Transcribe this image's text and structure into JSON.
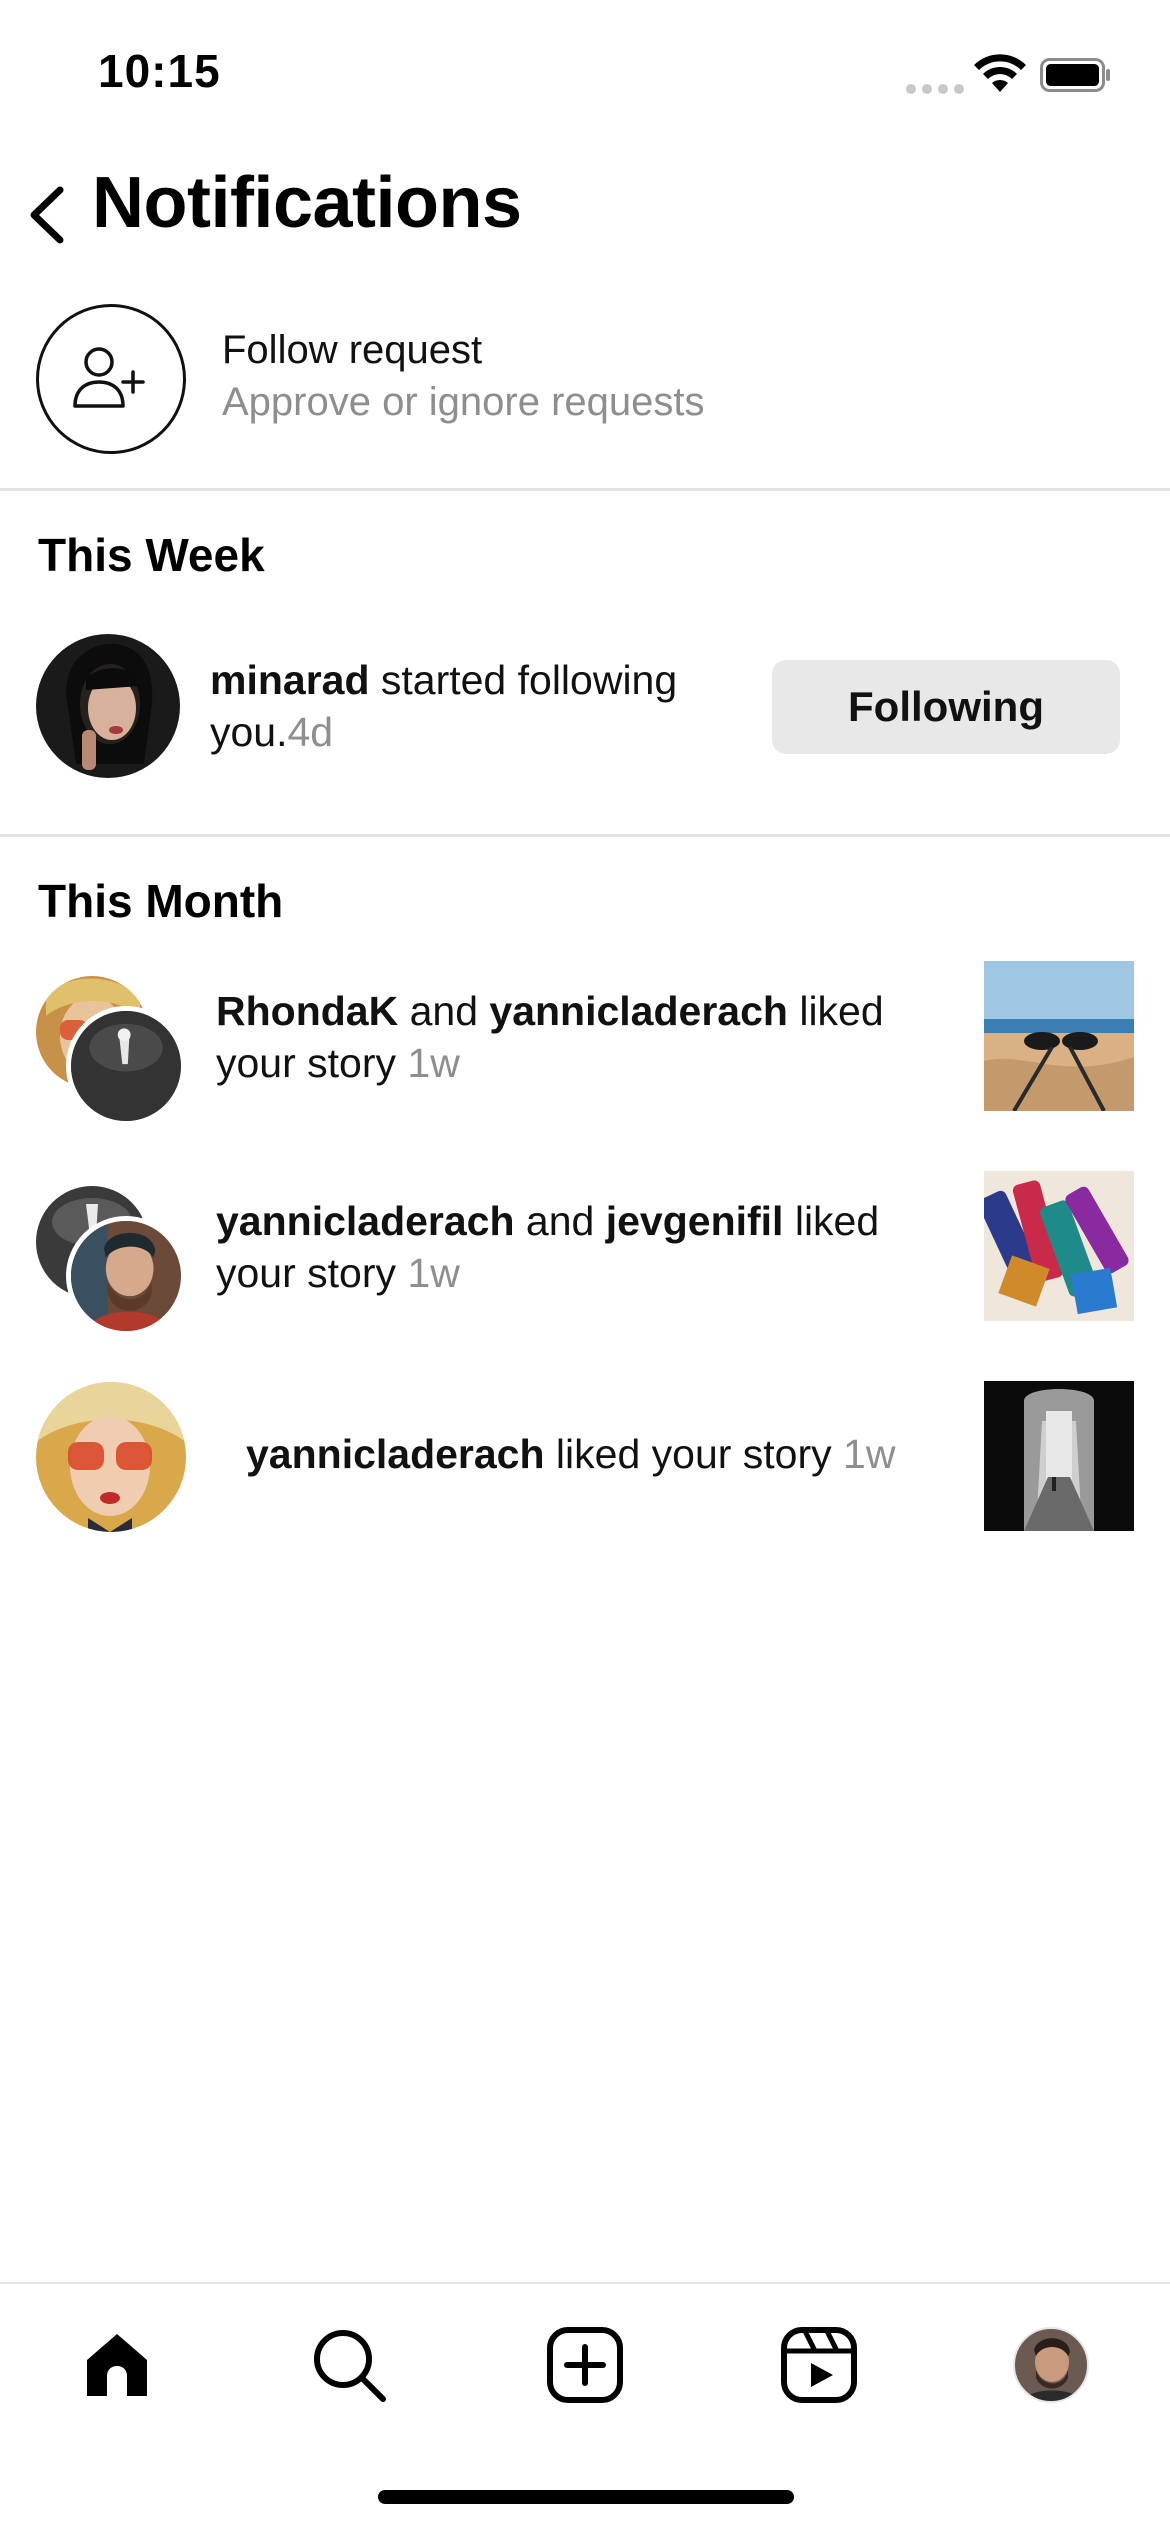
{
  "status_bar": {
    "time": "10:15"
  },
  "header": {
    "title": "Notifications"
  },
  "follow_request": {
    "title": "Follow request",
    "subtitle": "Approve or ignore requests"
  },
  "sections": {
    "this_week": "This Week",
    "this_month": "This Month"
  },
  "week_items": [
    {
      "user": "minarad",
      "text": " started following you.",
      "time": "4d",
      "button_label": "Following"
    }
  ],
  "month_items": [
    {
      "user1": "RhondaK",
      "conj": " and ",
      "user2": "yannicladerach",
      "text": " liked your story",
      "time": "1w"
    },
    {
      "user1": "yannicladerach",
      "conj": " and ",
      "user2": "jevgenifil",
      "text": " liked your story",
      "time": "1w"
    },
    {
      "user1": "yannicladerach",
      "text": " liked your story",
      "time": "1w"
    }
  ],
  "tab_bar": {
    "icons": [
      "home-icon",
      "search-icon",
      "new-post-icon",
      "reels-icon",
      "profile-avatar"
    ]
  },
  "colors": {
    "muted_text": "#8e8e8e",
    "button_bg": "#e8e8e8",
    "divider": "#e3e3e3"
  }
}
